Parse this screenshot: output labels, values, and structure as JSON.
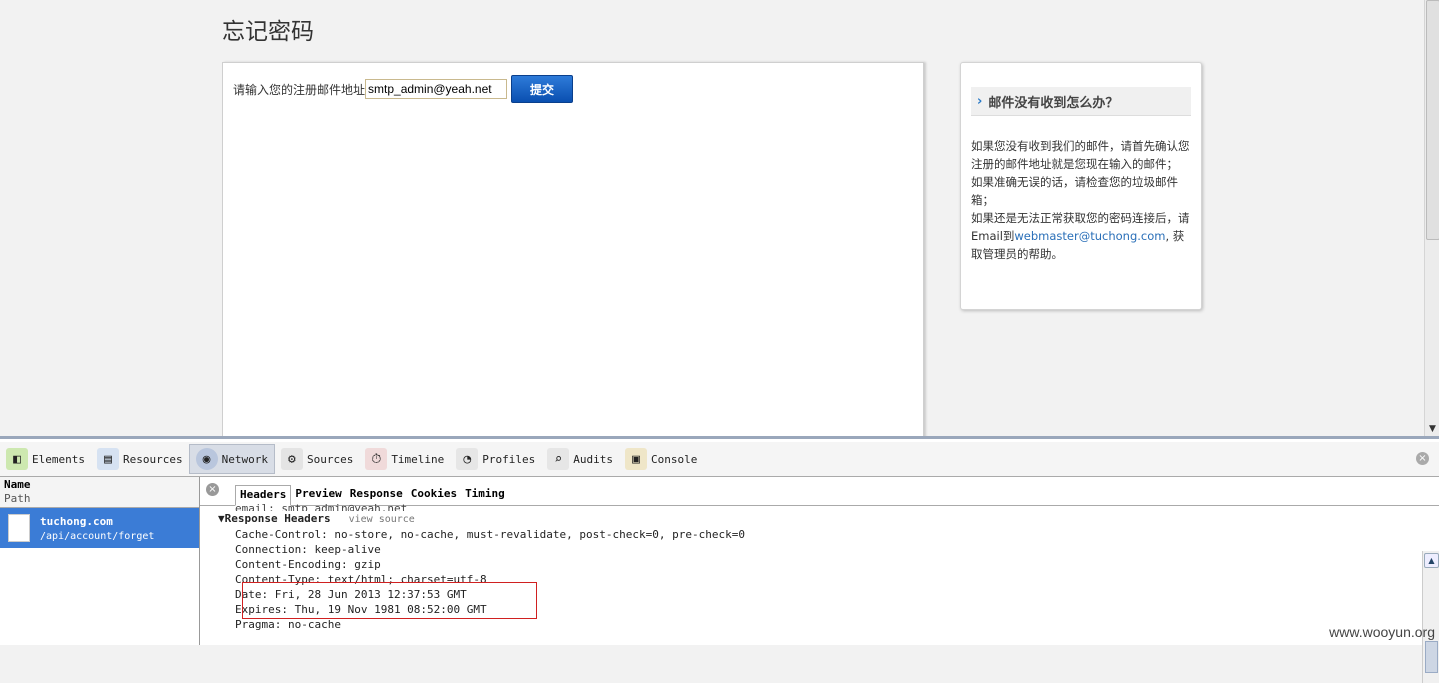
{
  "page": {
    "title": "忘记密码",
    "email_label": "请输入您的注册邮件地址",
    "email_value": "smtp_admin@yeah.net",
    "submit_label": "提交"
  },
  "help": {
    "title": "邮件没有收到怎么办？",
    "line1": "如果您没有收到我们的邮件，请首先确认您注册的邮件地址就是您现在输入的邮件；",
    "line2": "如果准确无误的话，请检查您的垃圾邮件箱；",
    "line3_pre": "如果还是无法正常获取您的密码连接后，请Email到",
    "line3_link": "webmaster@tuchong.com",
    "line3_post": ", 获取管理员的帮助。"
  },
  "devtools": {
    "toolbar": [
      "Elements",
      "Resources",
      "Network",
      "Sources",
      "Timeline",
      "Profiles",
      "Audits",
      "Console"
    ],
    "columns": {
      "name": "Name",
      "path": "Path"
    },
    "request": {
      "host": "tuchong.com",
      "path": "/api/account/forget"
    },
    "tabs": [
      "Headers",
      "Preview",
      "Response",
      "Cookies",
      "Timing"
    ],
    "cut_line": "email: smtp_admin@yeah.net",
    "section": "Response Headers",
    "view_source": "view source",
    "headers": [
      "Cache-Control: no-store, no-cache, must-revalidate, post-check=0, pre-check=0",
      "Connection: keep-alive",
      "Content-Encoding: gzip",
      "Content-Type: text/html; charset=utf-8",
      "Date: Fri, 28 Jun 2013 12:37:53 GMT",
      "Expires: Thu, 19 Nov 1981 08:52:00 GMT",
      "Pragma: no-cache"
    ]
  },
  "watermark": "www.wooyun.org"
}
